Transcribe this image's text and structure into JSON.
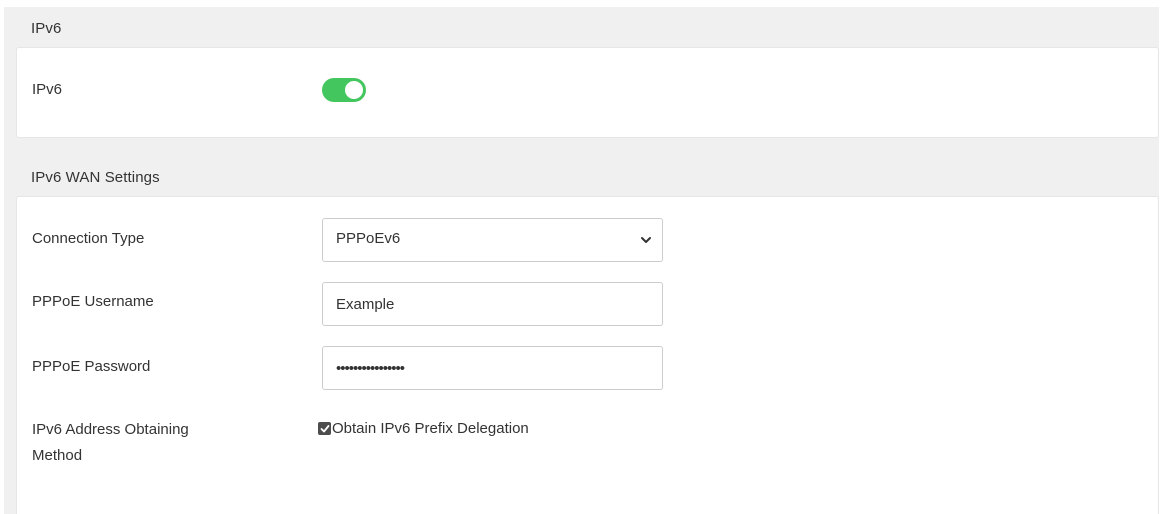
{
  "ipv6_section": {
    "title": "IPv6",
    "toggle_label": "IPv6",
    "toggle_on": true,
    "toggle_color": "#44c65e"
  },
  "wan_section": {
    "title": "IPv6 WAN Settings",
    "connection_type": {
      "label": "Connection Type",
      "selected": "PPPoEv6"
    },
    "pppoe_username": {
      "label": "PPPoE Username",
      "value": "Example"
    },
    "pppoe_password": {
      "label": "PPPoE Password",
      "value": "••••••••••••••••"
    },
    "address_method": {
      "label_line1": "IPv6 Address Obtaining",
      "label_line2": "Method",
      "checkbox_label": "Obtain IPv6 Prefix Delegation",
      "checked": true
    }
  }
}
